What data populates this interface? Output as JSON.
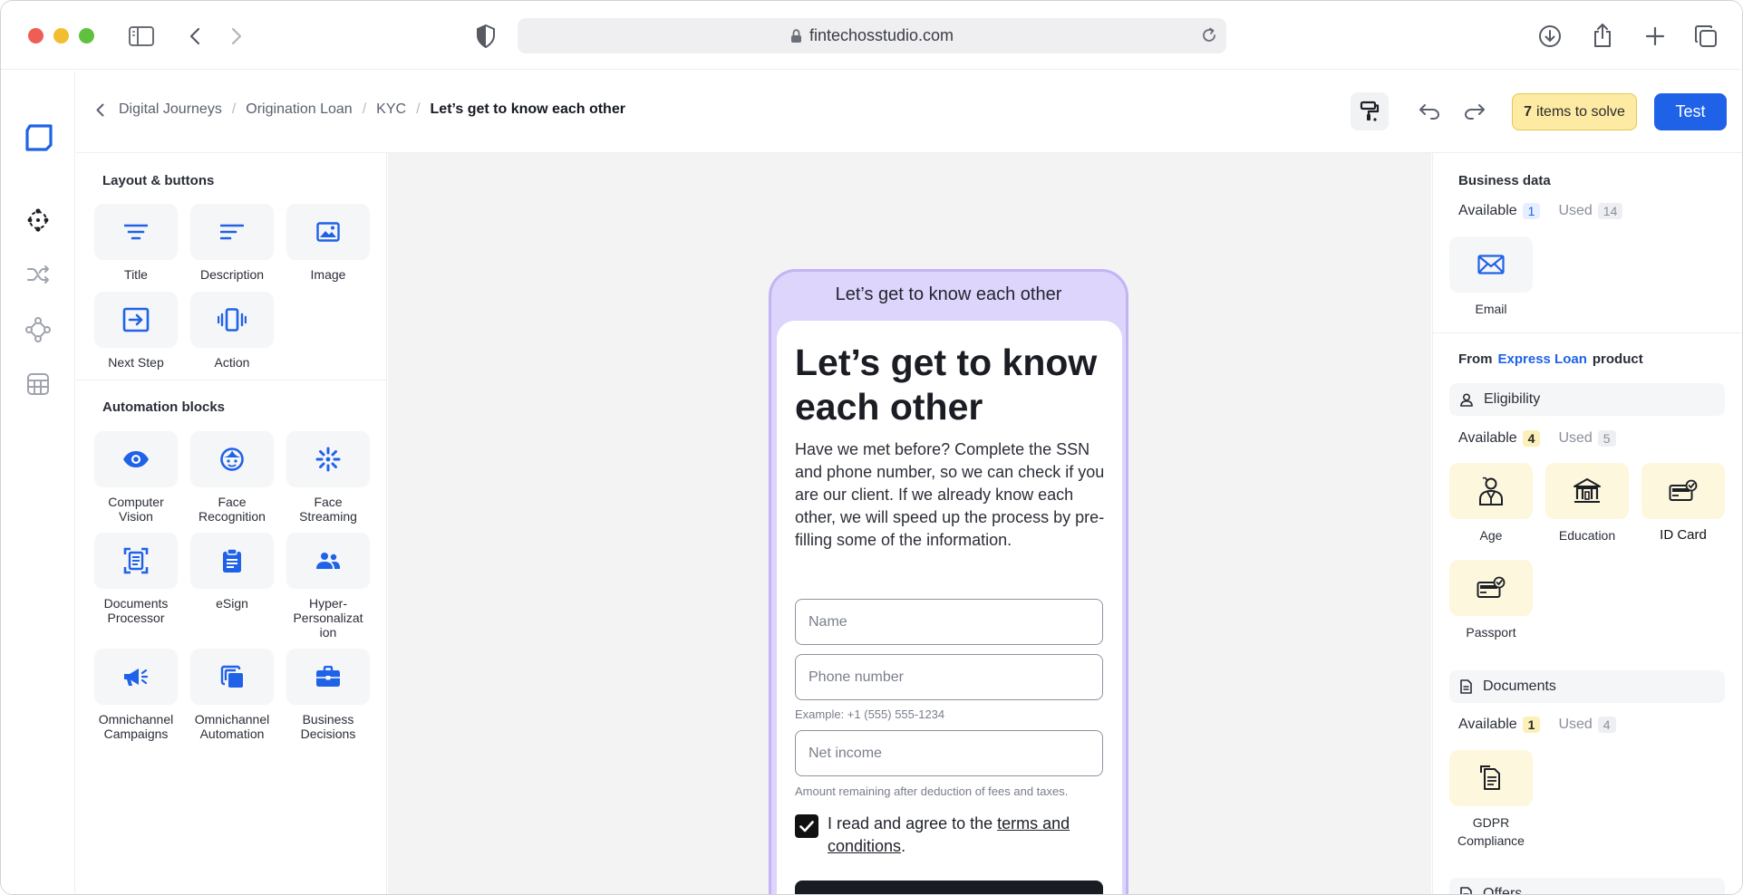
{
  "browser": {
    "url": "fintechosstudio.com",
    "traffic_lights": [
      "#ee5e56",
      "#f2bd2e",
      "#5fc13e"
    ],
    "icons": [
      "sidebar-toggle-icon",
      "back-icon",
      "forward-icon",
      "shield-icon",
      "lock-icon",
      "reload-icon",
      "download-icon",
      "share-icon",
      "new-tab-icon",
      "tabs-overview-icon"
    ]
  },
  "rail": {
    "icons": [
      "logo-icon",
      "journey-nodes-icon",
      "shuffle-icon",
      "connections-icon",
      "grid-icon"
    ]
  },
  "breadcrumb": {
    "items": [
      "Digital Journeys",
      "Origination Loan",
      "KYC"
    ],
    "current": "Let’s get to know each other"
  },
  "toolbar": {
    "solve_count": "7",
    "solve_label": "items to solve",
    "test_label": "Test",
    "accent": "#1f62e8"
  },
  "left_panel": {
    "layout_title": "Layout & buttons",
    "layout_items": [
      {
        "label": "Title",
        "icon": "title-icon"
      },
      {
        "label": "Description",
        "icon": "description-icon"
      },
      {
        "label": "Image",
        "icon": "image-icon"
      },
      {
        "label": "Next Step",
        "icon": "next-step-icon"
      },
      {
        "label": "Action",
        "icon": "action-icon"
      }
    ],
    "automation_title": "Automation blocks",
    "automation_items": [
      {
        "label": "Computer Vision",
        "icon": "eye-icon"
      },
      {
        "label": "Face Recognition",
        "icon": "face-icon"
      },
      {
        "label": "Face Streaming",
        "icon": "streaming-icon"
      },
      {
        "label": "Documents Processor",
        "icon": "document-scan-icon"
      },
      {
        "label": "eSign",
        "icon": "clipboard-icon"
      },
      {
        "label": "Hyper-Personalizat ion",
        "icon": "people-icon"
      },
      {
        "label": "Omnichannel Campaigns",
        "icon": "megaphone-icon"
      },
      {
        "label": "Omnichannel Automation",
        "icon": "copy-icon"
      },
      {
        "label": "Business Decisions",
        "icon": "briefcase-icon"
      }
    ]
  },
  "phone": {
    "header": "Let’s get to know each other",
    "title": "Let’s get to know each other",
    "description": "Have we met before? Complete the SSN and phone number, so we can check if you are our client. If we already know each other, we will speed up the process by pre-filling some of the information.",
    "name_placeholder": "Name",
    "phone_placeholder": "Phone number",
    "phone_hint": "Example: +1 (555) 555-1234",
    "income_placeholder": "Net income",
    "income_hint": "Amount remaining after deduction of fees and taxes.",
    "checkbox_text": "I read and agree to the ",
    "checkbox_link": "terms and conditions",
    "checkbox_end": ".",
    "checkbox_checked": true
  },
  "right_panel": {
    "business_title": "Business data",
    "business_available_label": "Available",
    "business_available": "1",
    "business_used_label": "Used",
    "business_used": "14",
    "business_items": [
      {
        "label": "Email",
        "icon": "mail-icon"
      }
    ],
    "from_label": "From",
    "from_product": "Express Loan",
    "product_label": "product",
    "eligibility_label": "Eligibility",
    "elig_available_label": "Available",
    "elig_available": "4",
    "elig_used_label": "Used",
    "elig_used": "5",
    "elig_items": [
      {
        "label": "Age",
        "icon": "person-icon"
      },
      {
        "label": "Education",
        "icon": "institution-icon"
      },
      {
        "label": "ID Card",
        "icon": "id-card-icon"
      },
      {
        "label": "Passport",
        "icon": "passport-icon"
      }
    ],
    "documents_label": "Documents",
    "docs_available_label": "Available",
    "docs_available": "1",
    "docs_used_label": "Used",
    "docs_used": "4",
    "doc_items": [
      {
        "label": "GDPR Compliance",
        "icon": "files-icon"
      }
    ],
    "offers_label": "Offers"
  }
}
